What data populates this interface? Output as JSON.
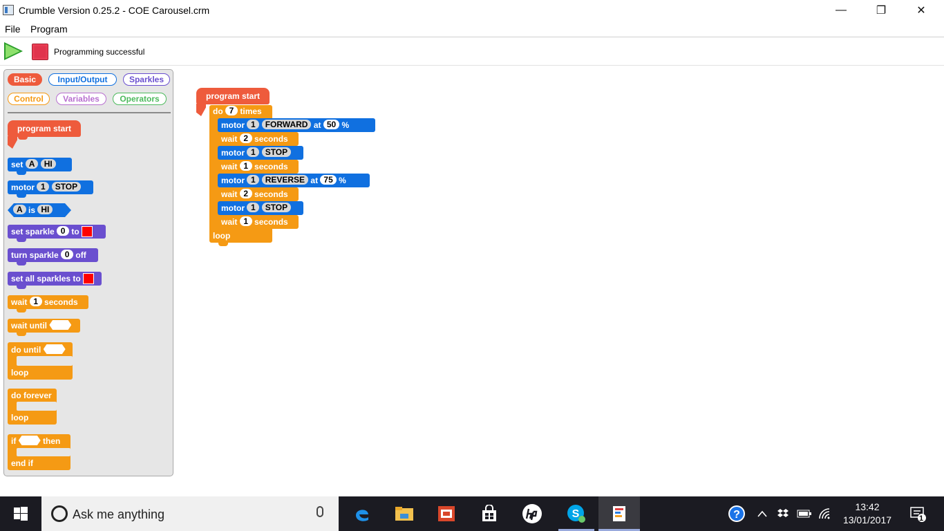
{
  "window": {
    "title": "Crumble Version 0.25.2 - COE Carousel.crm",
    "minimize": "—",
    "maximize": "❐",
    "close": "✕"
  },
  "menu": [
    "File",
    "Program"
  ],
  "toolbar": {
    "status": "Programming successful",
    "colors": {
      "run": "#2a9d2a",
      "stop": "#e0344d"
    }
  },
  "palette": {
    "categories": [
      {
        "label": "Basic",
        "color": "#ee5b3c",
        "active": true
      },
      {
        "label": "Input/Output",
        "color": "#1070e0"
      },
      {
        "label": "Sparkles",
        "color": "#6a4fcf"
      },
      {
        "label": "Control",
        "color": "#f59a14"
      },
      {
        "label": "Variables",
        "color": "#b86fd0"
      },
      {
        "label": "Operators",
        "color": "#4cba5c"
      }
    ],
    "program_start": "program start",
    "set": {
      "label": "set",
      "var": "A",
      "value": "HI"
    },
    "motor": {
      "label": "motor",
      "num": "1",
      "dir": "STOP"
    },
    "is": {
      "var": "A",
      "label": "is",
      "value": "HI"
    },
    "set_sparkle": {
      "label": "set sparkle",
      "num": "0",
      "to": "to"
    },
    "turn_sparkle": {
      "label": "turn sparkle",
      "num": "0",
      "off": "off"
    },
    "set_all": {
      "label": "set all sparkles to"
    },
    "wait": {
      "label": "wait",
      "num": "1",
      "unit": "seconds"
    },
    "wait_until": "wait until",
    "do_until": "do until",
    "loop": "loop",
    "do_forever": "do forever",
    "if": "if",
    "then": "then",
    "end_if": "end if"
  },
  "script": {
    "start": "program start",
    "do": "do",
    "times_count": "7",
    "times": "times",
    "loop": "loop",
    "motor_label": "motor",
    "wait_label": "wait",
    "at": "at",
    "pct": "%",
    "seconds": "seconds",
    "steps": [
      {
        "type": "motor",
        "num": "1",
        "dir": "FORWARD",
        "speed": "50"
      },
      {
        "type": "wait",
        "num": "2"
      },
      {
        "type": "motor",
        "num": "1",
        "dir": "STOP"
      },
      {
        "type": "wait",
        "num": "1"
      },
      {
        "type": "motor",
        "num": "1",
        "dir": "REVERSE",
        "speed": "75"
      },
      {
        "type": "wait",
        "num": "2"
      },
      {
        "type": "motor",
        "num": "1",
        "dir": "STOP"
      },
      {
        "type": "wait",
        "num": "1"
      }
    ]
  },
  "taskbar": {
    "search_placeholder": "Ask me anything",
    "time": "13:42",
    "date": "13/01/2017",
    "notifications": "1"
  }
}
